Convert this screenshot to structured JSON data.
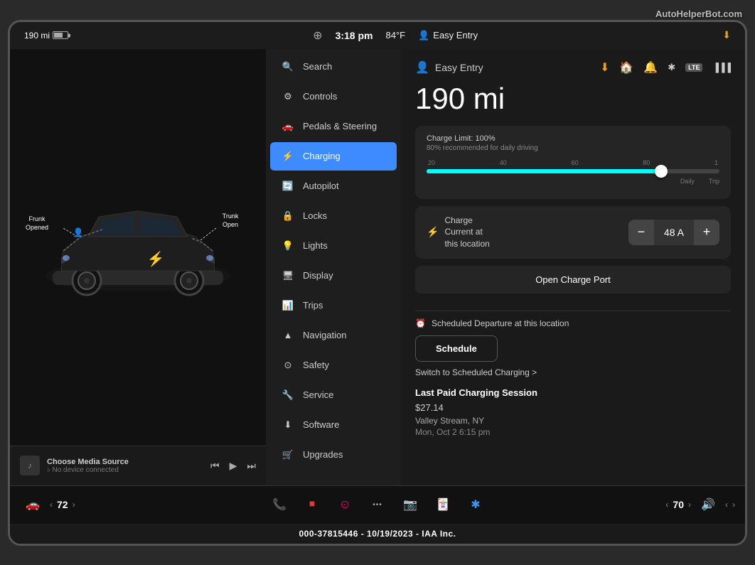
{
  "watermark": "AutoHelperBot.com",
  "statusBar": {
    "range": "190 mi",
    "time": "3:18 pm",
    "temp": "84°F",
    "easyEntry": "Easy Entry",
    "profile_icon": "person"
  },
  "leftPanel": {
    "frunkLabel": "Frunk\nOpened",
    "trunkLabel": "Trunk\nOpen",
    "mediaSource": "Choose Media Source",
    "mediaSubtext": "♭ No device connected",
    "mediaControls": {
      "prev": "⏮",
      "play": "▶",
      "next": "⏭"
    }
  },
  "navMenu": {
    "items": [
      {
        "id": "search",
        "label": "Search",
        "icon": "🔍",
        "active": false
      },
      {
        "id": "controls",
        "label": "Controls",
        "icon": "⚙",
        "active": false
      },
      {
        "id": "pedals",
        "label": "Pedals & Steering",
        "icon": "🚗",
        "active": false
      },
      {
        "id": "charging",
        "label": "Charging",
        "icon": "⚡",
        "active": true
      },
      {
        "id": "autopilot",
        "label": "Autopilot",
        "icon": "🔄",
        "active": false
      },
      {
        "id": "locks",
        "label": "Locks",
        "icon": "🔒",
        "active": false
      },
      {
        "id": "lights",
        "label": "Lights",
        "icon": "💡",
        "active": false
      },
      {
        "id": "display",
        "label": "Display",
        "icon": "🖥",
        "active": false
      },
      {
        "id": "trips",
        "label": "Trips",
        "icon": "📊",
        "active": false
      },
      {
        "id": "navigation",
        "label": "Navigation",
        "icon": "🧭",
        "active": false
      },
      {
        "id": "safety",
        "label": "Safety",
        "icon": "🛡",
        "active": false
      },
      {
        "id": "service",
        "label": "Service",
        "icon": "🔧",
        "active": false
      },
      {
        "id": "software",
        "label": "Software",
        "icon": "⬇",
        "active": false
      },
      {
        "id": "upgrades",
        "label": "Upgrades",
        "icon": "🛒",
        "active": false
      }
    ]
  },
  "chargingPanel": {
    "title": "Easy Entry",
    "rangeDisplay": "190 mi",
    "chargeLimit": {
      "title": "Charge Limit: 100%",
      "subtitle": "80% recommended for daily driving",
      "sliderPercent": 80,
      "labels": [
        "20",
        "40",
        "60",
        "80",
        "1"
      ],
      "dailyLabel": "Daily",
      "tripLabel": "Trip"
    },
    "chargeCurrent": {
      "label": "Charge Current at this location",
      "value": "48 A",
      "decreaseBtn": "−",
      "increaseBtn": "+"
    },
    "openChargePortBtn": "Open Charge Port",
    "scheduledDeparture": {
      "title": "Scheduled Departure at this location",
      "scheduleBtn": "Schedule",
      "switchLink": "Switch to Scheduled Charging >"
    },
    "lastSession": {
      "title": "Last Paid Charging Session",
      "amount": "$27.14",
      "location": "Valley Stream, NY",
      "dateTime": "Mon, Oct 2 6:15 pm"
    }
  },
  "taskbar": {
    "leftTemp": "72",
    "rightTemp": "70",
    "carIcon": "🚗",
    "leftArrow": "‹",
    "rightArrow": "›",
    "phoneIcon": "📞",
    "stopIcon": "⏹",
    "circleIcon": "⊙",
    "dotsIcon": "···",
    "cameraIcon": "📷",
    "cardIcon": "🃏",
    "bluetoothIcon": "🔵",
    "volIcon": "🔊",
    "volArrowLeft": "‹",
    "volArrowRight": "›"
  },
  "footer": {
    "text": "000-37815446 - 10/19/2023 - IAA Inc."
  }
}
